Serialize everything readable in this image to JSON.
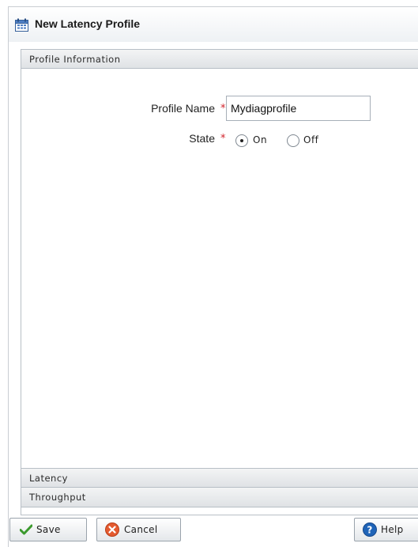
{
  "dialog": {
    "title": "New Latency Profile",
    "title_icon": "calendar-profile-icon"
  },
  "accordion": {
    "profile_info_label": "Profile Information",
    "latency_label": "Latency",
    "throughput_label": "Throughput"
  },
  "form": {
    "profile_name_label": "Profile Name",
    "profile_name_value": "Mydiagprofile",
    "required_mark": "*",
    "state_label": "State",
    "state_options": [
      "On",
      "Off"
    ],
    "state_selected": "On"
  },
  "buttons": {
    "save_label": "Save",
    "cancel_label": "Cancel",
    "help_label": "Help"
  },
  "colors": {
    "required": "#d1232b",
    "save_check": "#3c9a2e",
    "cancel_icon": "#e45a2f",
    "help_icon": "#1f64b8"
  }
}
